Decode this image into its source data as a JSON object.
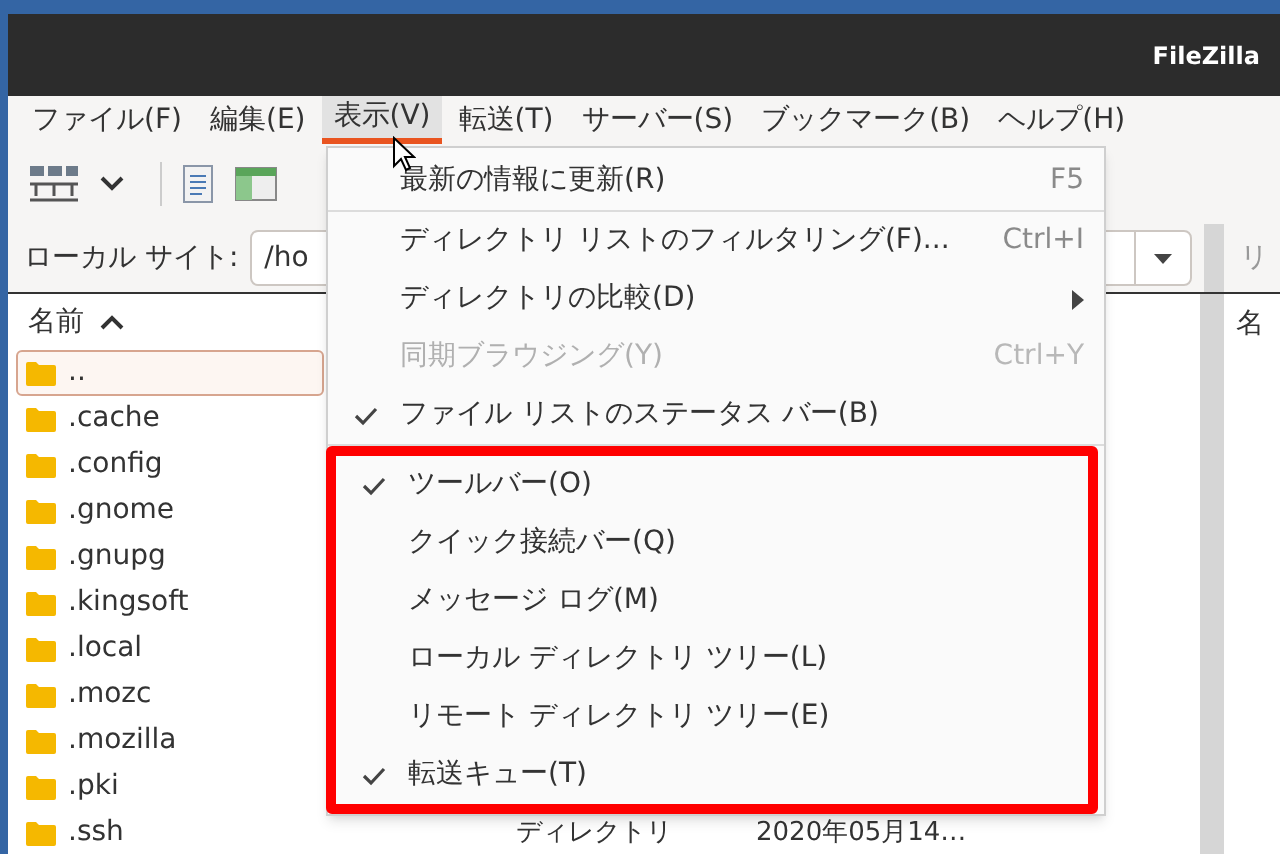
{
  "window": {
    "title": "FileZilla"
  },
  "menubar": [
    {
      "label": "ファイル(F)",
      "selected": false
    },
    {
      "label": "編集(E)",
      "selected": false
    },
    {
      "label": "表示(V)",
      "selected": true
    },
    {
      "label": "転送(T)",
      "selected": false
    },
    {
      "label": "サーバー(S)",
      "selected": false
    },
    {
      "label": "ブックマーク(B)",
      "selected": false
    },
    {
      "label": "ヘルプ(H)",
      "selected": false
    }
  ],
  "local_site": {
    "label": "ローカル サイト:",
    "value": "/ho"
  },
  "local_files": {
    "column": "名前",
    "rows": [
      {
        "name": "..",
        "selected": true
      },
      {
        "name": ".cache",
        "selected": false
      },
      {
        "name": ".config",
        "selected": false
      },
      {
        "name": ".gnome",
        "selected": false
      },
      {
        "name": ".gnupg",
        "selected": false
      },
      {
        "name": ".kingsoft",
        "selected": false
      },
      {
        "name": ".local",
        "selected": false
      },
      {
        "name": ".mozc",
        "selected": false
      },
      {
        "name": ".mozilla",
        "selected": false
      },
      {
        "name": ".pki",
        "selected": false
      },
      {
        "name": ".ssh",
        "selected": false,
        "column_2": "ディレクトリ",
        "column_3": "2020年05月14…"
      }
    ]
  },
  "remote_site": {
    "label": "リ",
    "column": "名"
  },
  "view_menu": {
    "sections": [
      {
        "highlighted": false,
        "items": [
          {
            "kind": "item",
            "label": "最新の情報に更新(R)",
            "shortcut": "F5",
            "checked": false,
            "disabled": false
          }
        ]
      },
      {
        "highlighted": false,
        "items": [
          {
            "kind": "item",
            "label": "ディレクトリ リストのフィルタリング(F)...",
            "shortcut": "Ctrl+I",
            "checked": false,
            "disabled": false
          },
          {
            "kind": "submenu",
            "label": "ディレクトリの比較(D)",
            "checked": false,
            "disabled": false
          },
          {
            "kind": "item",
            "label": "同期ブラウジング(Y)",
            "shortcut": "Ctrl+Y",
            "checked": false,
            "disabled": true
          },
          {
            "kind": "item",
            "label": "ファイル リストのステータス バー(B)",
            "checked": true,
            "disabled": false
          }
        ]
      },
      {
        "highlighted": true,
        "items": [
          {
            "kind": "item",
            "label": "ツールバー(O)",
            "checked": true,
            "disabled": false
          },
          {
            "kind": "item",
            "label": "クイック接続バー(Q)",
            "checked": false,
            "disabled": false
          },
          {
            "kind": "item",
            "label": "メッセージ ログ(M)",
            "checked": false,
            "disabled": false
          },
          {
            "kind": "item",
            "label": "ローカル ディレクトリ ツリー(L)",
            "checked": false,
            "disabled": false
          },
          {
            "kind": "item",
            "label": "リモート ディレクトリ ツリー(E)",
            "checked": false,
            "disabled": false
          },
          {
            "kind": "item",
            "label": "転送キュー(T)",
            "checked": true,
            "disabled": false
          }
        ]
      }
    ]
  }
}
